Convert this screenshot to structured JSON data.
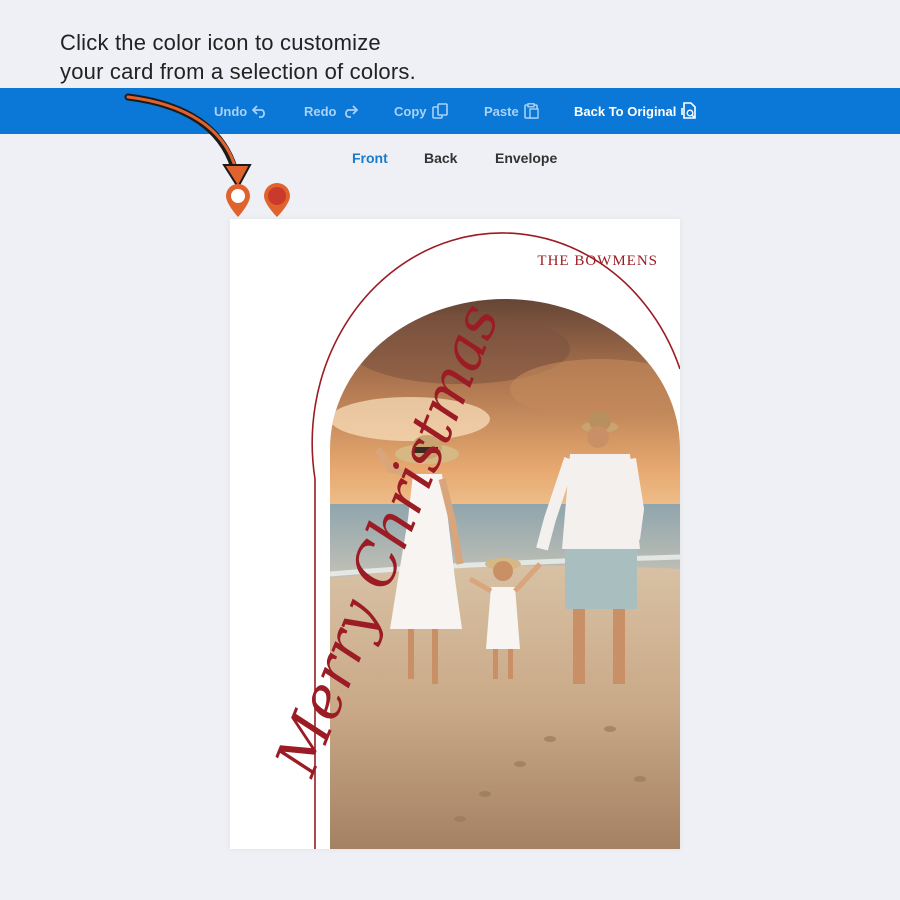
{
  "instruction": {
    "line1": "Click the color icon to customize",
    "line2": "your card from a selection of colors."
  },
  "toolbar": {
    "undo": "Undo",
    "redo": "Redo",
    "copy": "Copy",
    "paste": "Paste",
    "back_to_original": "Back To Original"
  },
  "tabs": [
    {
      "label": "Front",
      "active": true
    },
    {
      "label": "Back",
      "active": false
    },
    {
      "label": "Envelope",
      "active": false
    }
  ],
  "color_options": [
    {
      "name": "outline-orange-pin-icon",
      "color": "#e0622d",
      "selected": true
    },
    {
      "name": "red-pin-icon",
      "color": "#c93a2c",
      "selected": false
    }
  ],
  "card": {
    "family_name": "THE BOWMENS",
    "greeting": "Merry Christmas",
    "accent_color": "#9b1c24"
  }
}
